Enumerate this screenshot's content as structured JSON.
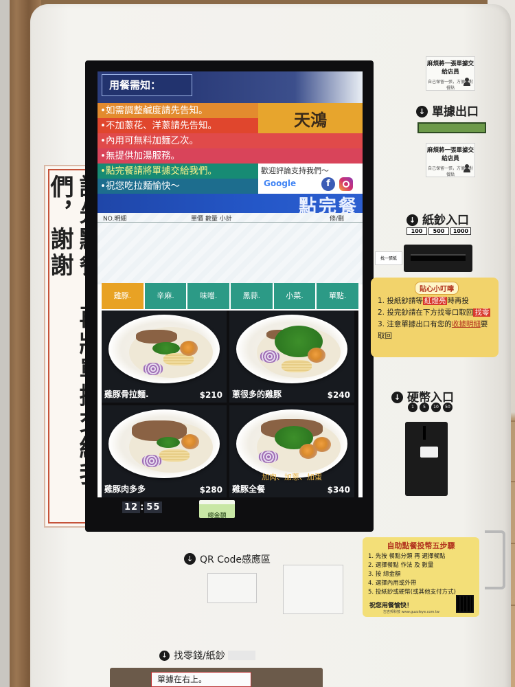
{
  "banner": {
    "text": "請先點餐，再將單據交給我們，謝謝"
  },
  "notice": {
    "title": "用餐需知：",
    "lines": [
      "•如需調整鹹度請先告知。",
      "•不加蔥花、洋蔥請先告知。",
      "•內用可無料加麵乙次。",
      "•無提供加湯服務。",
      "•點完餐請將單據交給我們。",
      "•祝您吃拉麵愉快～"
    ],
    "logo": "天鴻",
    "review_text": "歡迎評論支持我們～",
    "google": "Google",
    "facebook_icon": "facebook-icon",
    "instagram_icon": "instagram-icon"
  },
  "done_banner": "點完餐",
  "order_table": {
    "col_no": "NO.明細",
    "col_price": "單價 數量 小計",
    "col_edit": "修/刪"
  },
  "tabs": [
    {
      "label": "雞豚.",
      "active": true
    },
    {
      "label": "辛麻.",
      "active": false
    },
    {
      "label": "味噌.",
      "active": false
    },
    {
      "label": "黑蒜.",
      "active": false
    },
    {
      "label": "小菜.",
      "active": false
    },
    {
      "label": "單點.",
      "active": false
    }
  ],
  "menu": [
    {
      "name": "雞豚骨拉麵.",
      "price": "$210",
      "note": ""
    },
    {
      "name": "蔥很多的雞豚",
      "price": "$240",
      "note": ""
    },
    {
      "name": "雞豚肉多多",
      "price": "$280",
      "note": ""
    },
    {
      "name": "雞豚全餐",
      "price": "$340",
      "note": "加肉、加蔥、加蛋"
    }
  ],
  "clock": {
    "hour": "12",
    "minute": "55"
  },
  "total_button": "總金額",
  "right_panel": {
    "sticker_main": "麻煩將一張單據交給店員",
    "sticker_sub": "自己保留一張，方便核對餐點",
    "receipt_out": "單據出口",
    "bill_in": "紙鈔入口",
    "bills": [
      "100",
      "500",
      "1000"
    ],
    "small_sticker": "找一張紙",
    "tips_title": "貼心小叮嚀",
    "tips": [
      {
        "pre": "1. 投紙鈔請等",
        "hl": "紅燈亮",
        "post": "時再投"
      },
      {
        "pre": "2. 投完鈔請在下方找零口取回",
        "hl": "找零",
        "post": ""
      },
      {
        "pre": "3. 注意單據出口有您的",
        "hl": "收據明細",
        "post": "要取回"
      }
    ],
    "coin_in": "硬幣入口",
    "coins": [
      "1",
      "5",
      "10",
      "50"
    ]
  },
  "steps": {
    "title": "自助點餐投幣五步驟",
    "items": [
      "1. 先按 餐點分類 再 選擇餐點",
      "2. 選擇餐點 作法 及 數量",
      "3. 按 總金額",
      "4. 選擇內用或外帶",
      "5. 投紙鈔或硬幣(或其他支付方式)"
    ],
    "footer": "祝您用餐愉快！",
    "brand": "古吉邦科技 www.guzzleye.com.tw"
  },
  "qr_label": "QR Code感應區",
  "change_label": "找零錢/紙鈔",
  "tray_note": "單據在右上。"
}
